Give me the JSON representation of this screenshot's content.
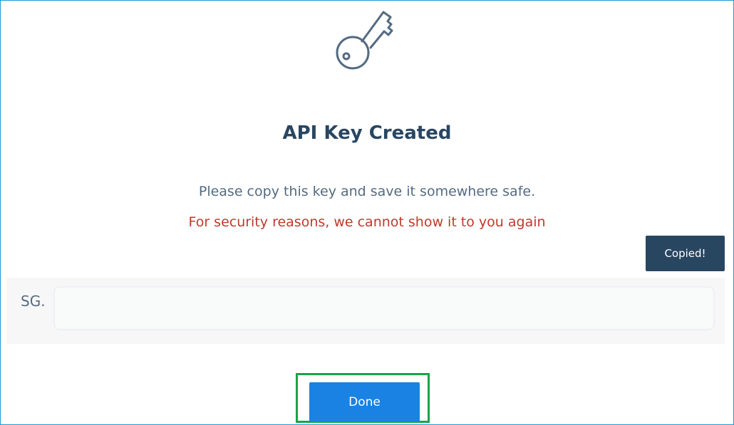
{
  "dialog": {
    "icon": "key-icon",
    "title": "API Key Created",
    "subtitle": "Please copy this key and save it somewhere safe.",
    "warning": "For security reasons, we cannot show it to you again",
    "copy_button_label": "Copied!",
    "key_prefix": "SG.",
    "key_value": "",
    "done_button_label": "Done"
  },
  "colors": {
    "border": "#1a9ad6",
    "title": "#294661",
    "subtitle": "#546b81",
    "warning": "#c0392b",
    "copy_button_bg": "#294661",
    "done_button_bg": "#1a82e2",
    "highlight": "#1aa34a"
  }
}
